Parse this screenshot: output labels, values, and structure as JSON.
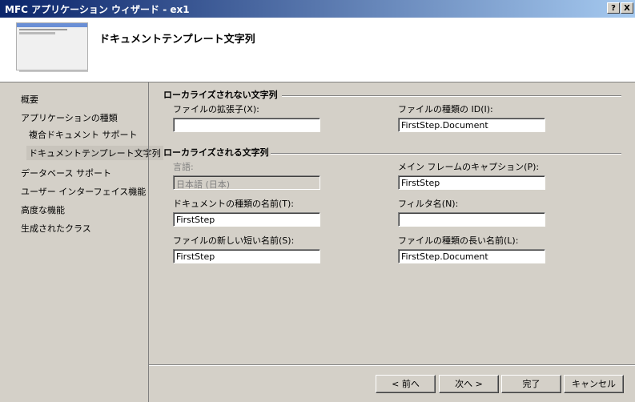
{
  "window": {
    "title": "MFC アプリケーション ウィザード - ex1",
    "help_button": "?",
    "close_button": "X"
  },
  "header": {
    "title": "ドキュメントテンプレート文字列"
  },
  "sidebar": {
    "items": [
      {
        "label": "概要"
      },
      {
        "label": "アプリケーションの種類"
      },
      {
        "label": "複合ドキュメント サポート"
      },
      {
        "label": "ドキュメントテンプレート文字列",
        "selected": true
      },
      {
        "label": "データベース サポート"
      },
      {
        "label": "ユーザー インターフェイス機能"
      },
      {
        "label": "高度な機能"
      },
      {
        "label": "生成されたクラス"
      }
    ]
  },
  "non_localized": {
    "title": "ローカライズされない文字列",
    "extension": {
      "label": "ファイルの拡張子(X):",
      "value": ""
    },
    "file_type_id": {
      "label": "ファイルの種類の ID(I):",
      "value": "FirstStep.Document"
    }
  },
  "localized": {
    "title": "ローカライズされる文字列",
    "language": {
      "label": "言語:",
      "value": "日本語 (日本)"
    },
    "main_caption": {
      "label": "メイン フレームのキャプション(P):",
      "value": "FirstStep"
    },
    "doc_type_name": {
      "label": "ドキュメントの種類の名前(T):",
      "value": "FirstStep"
    },
    "filter_name": {
      "label": "フィルタ名(N):",
      "value": ""
    },
    "new_short_name": {
      "label": "ファイルの新しい短い名前(S):",
      "value": "FirstStep"
    },
    "type_long_name": {
      "label": "ファイルの種類の長い名前(L):",
      "value": "FirstStep.Document"
    }
  },
  "buttons": {
    "back": "< 前へ",
    "next": "次へ >",
    "finish": "完了",
    "cancel": "キャンセル"
  }
}
